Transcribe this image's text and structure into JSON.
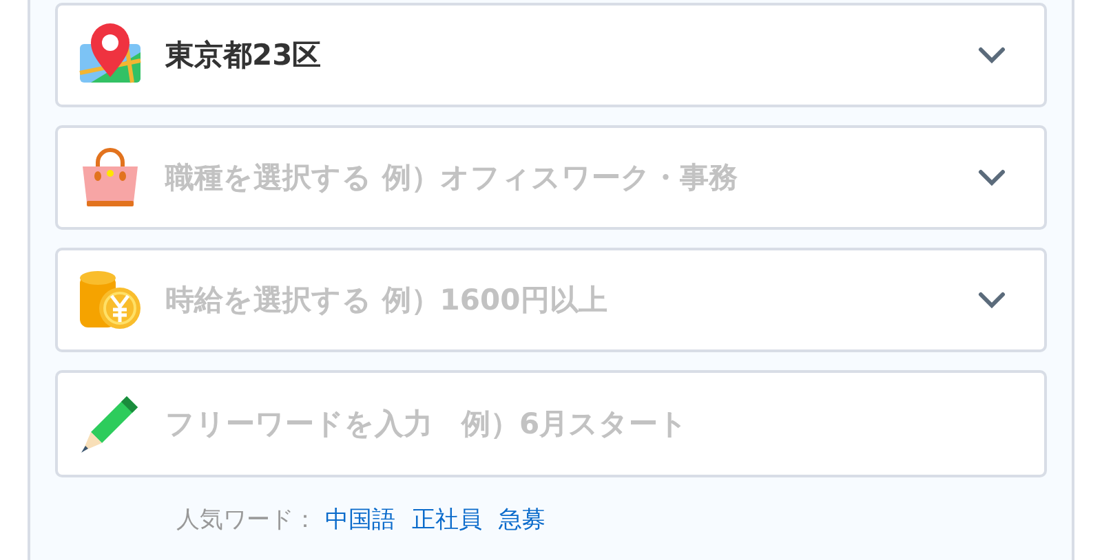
{
  "search_form": {
    "fields": [
      {
        "kind": "select",
        "value": "東京都23区"
      },
      {
        "kind": "select",
        "placeholder": "職種を選択する 例）オフィスワーク・事務"
      },
      {
        "kind": "select",
        "placeholder": "時給を選択する 例）1600円以上"
      },
      {
        "kind": "text",
        "placeholder": "フリーワードを入力　例）6月スタート"
      }
    ],
    "popular_words": {
      "label": "人気ワード：",
      "links": [
        "中国語",
        "正社員",
        "急募"
      ]
    }
  }
}
